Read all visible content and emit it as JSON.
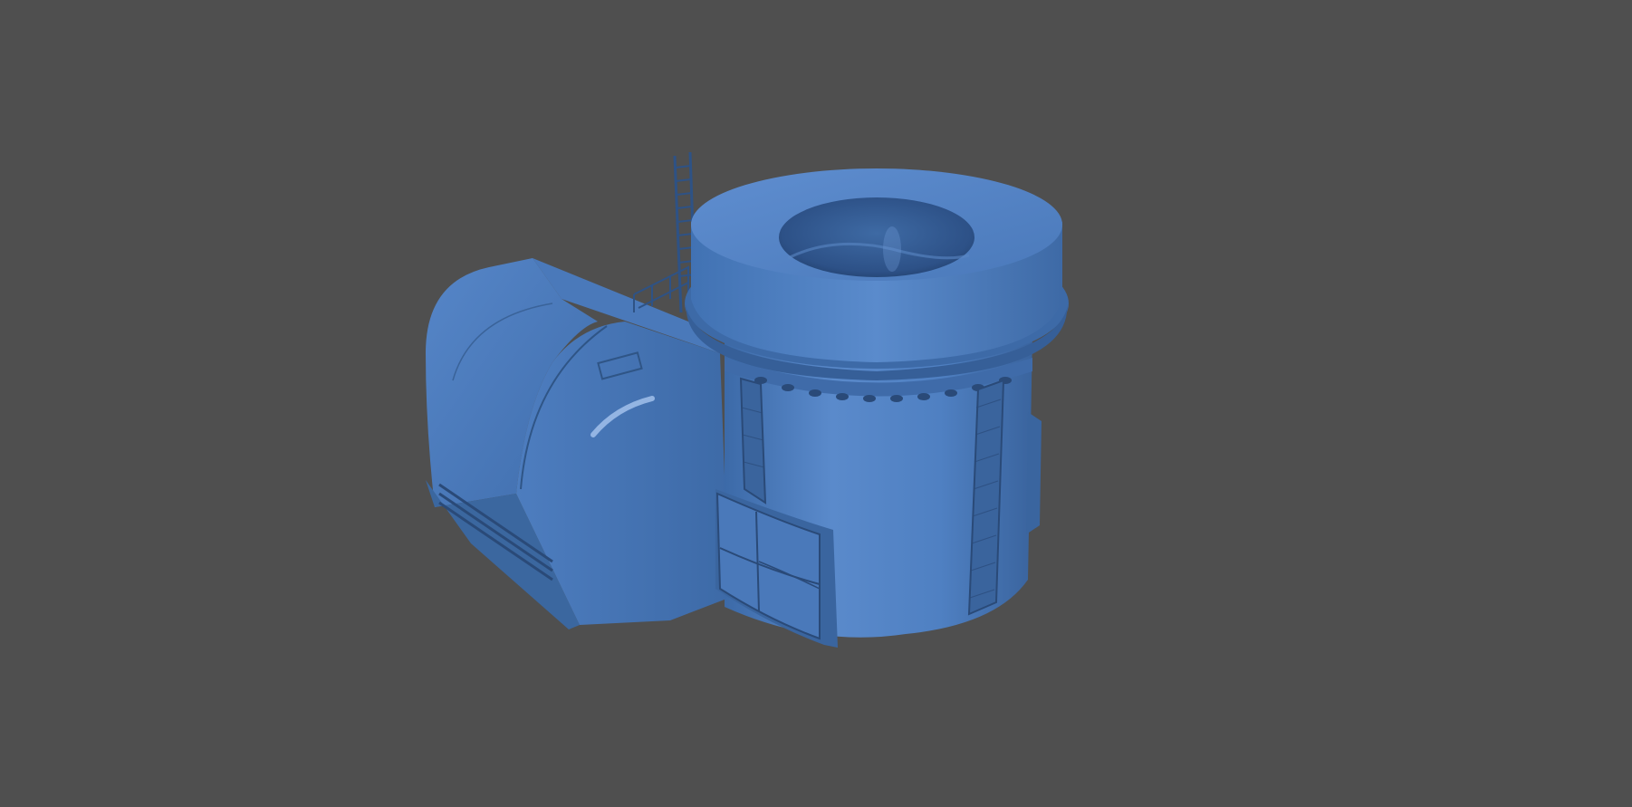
{
  "viewport": {
    "background_color": "#4f4f4f"
  },
  "model": {
    "material_color": "#4f7fc0",
    "highlight_color": "#7aa6e2",
    "shadow_color": "#2f5180",
    "line_color": "#2a4a78",
    "parts": [
      "cylindrical-tank",
      "ring-flange",
      "top-opening",
      "side-housing",
      "access-ladder",
      "railing",
      "curved-door-panel",
      "vertical-vent-strip"
    ]
  }
}
